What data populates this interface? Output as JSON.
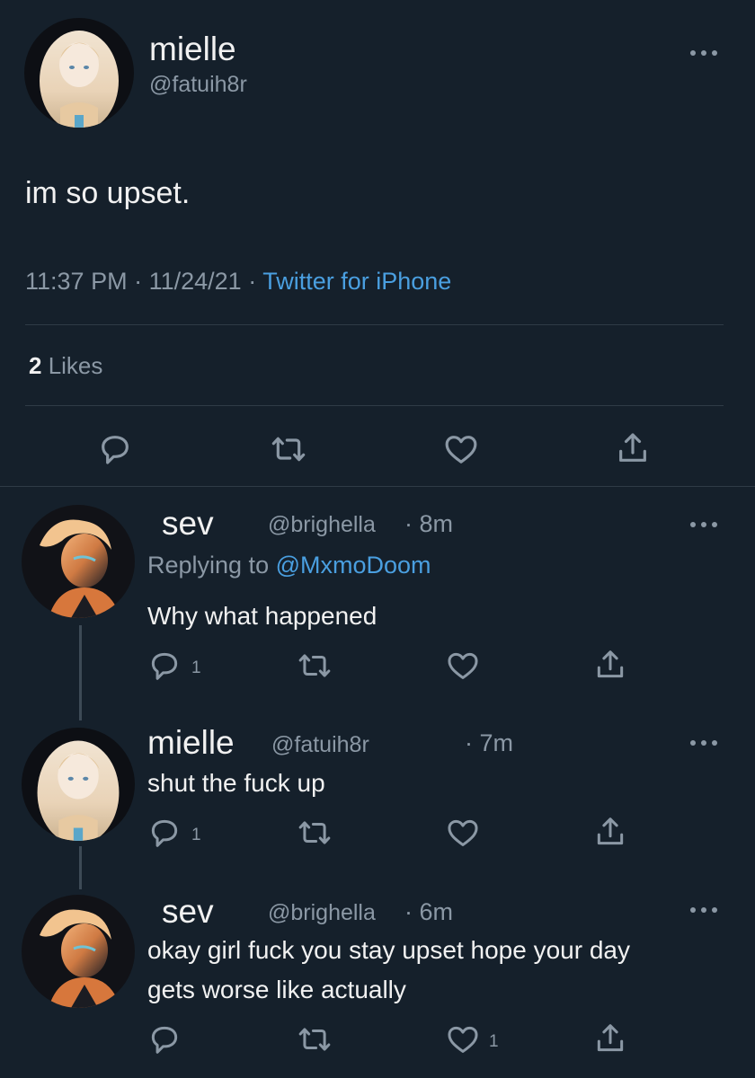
{
  "main_tweet": {
    "display_name": "mielle",
    "handle": "@fatuih8r",
    "text": "im so upset.",
    "time": "11:37 PM",
    "date_sep": " · ",
    "date": "11/24/21",
    "source_sep": " · ",
    "source": "Twitter for iPhone",
    "likes_count": "2",
    "likes_label": " Likes"
  },
  "replies": [
    {
      "display_name": "sev",
      "handle": "@brighella",
      "time": "· 8m",
      "replying_label": "Replying to ",
      "replying_to": "@MxmoDoom",
      "text": "Why what happened",
      "reply_count": "1",
      "like_count": ""
    },
    {
      "display_name": "mielle",
      "handle": "@fatuih8r",
      "time": "· 7m",
      "text": "shut the fuck up",
      "reply_count": "1",
      "like_count": ""
    },
    {
      "display_name": "sev",
      "handle": "@brighella",
      "time": "· 6m",
      "text_line1": "okay girl fuck you stay upset hope your day",
      "text_line2": "gets worse like actually",
      "reply_count": "",
      "like_count": "1"
    }
  ],
  "icons": [
    "reply-icon",
    "retweet-icon",
    "like-icon",
    "share-icon",
    "more-icon"
  ],
  "colors": {
    "background": "#15202b",
    "link": "#4a9fe0",
    "muted": "#8b98a5",
    "text": "#f1f1f1"
  }
}
